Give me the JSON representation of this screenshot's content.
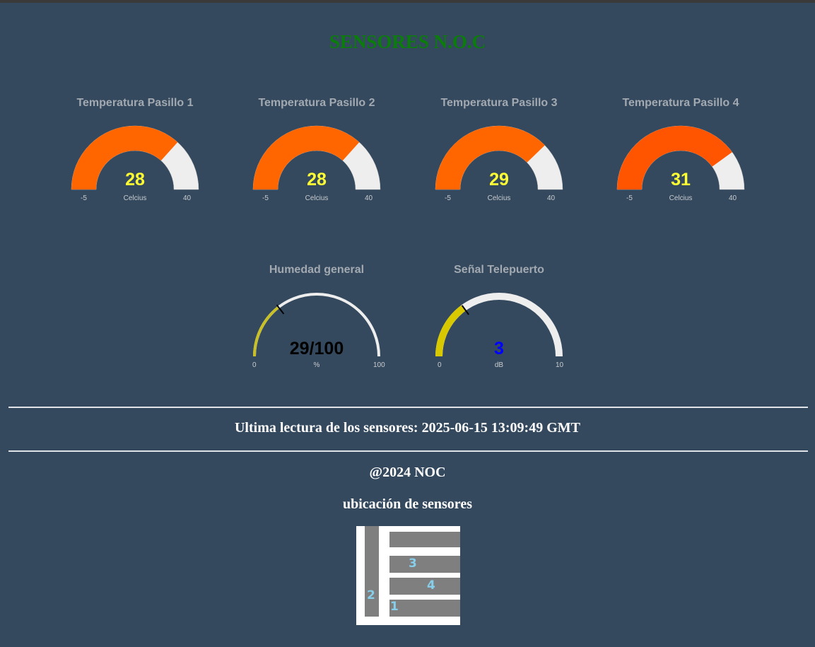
{
  "title": "SENSORES N.O.C",
  "temperature_gauges": [
    {
      "label": "Temperatura Pasillo 1",
      "value": 28,
      "unit": "Celcius",
      "min": -5,
      "max": 40,
      "fill_color": "#ff6600"
    },
    {
      "label": "Temperatura Pasillo 2",
      "value": 28,
      "unit": "Celcius",
      "min": -5,
      "max": 40,
      "fill_color": "#ff6600"
    },
    {
      "label": "Temperatura Pasillo 3",
      "value": 29,
      "unit": "Celcius",
      "min": -5,
      "max": 40,
      "fill_color": "#ff6600"
    },
    {
      "label": "Temperatura Pasillo 4",
      "value": 31,
      "unit": "Celcius",
      "min": -5,
      "max": 40,
      "fill_color": "#ff5500"
    }
  ],
  "humidity_gauge": {
    "label": "Humedad general",
    "value_text": "29/100",
    "value": 29,
    "unit": "%",
    "min": 0,
    "max": 100,
    "fill_color": "#c8c026",
    "value_color": "#000000"
  },
  "signal_gauge": {
    "label": "Señal Telepuerto",
    "value_text": "3",
    "value": 3,
    "unit": "dB",
    "min": 0,
    "max": 10,
    "fill_color": "#d8c800",
    "value_color": "#0000ff"
  },
  "last_reading": "Ultima lectura de los sensores: 2025-06-15 13:09:49 GMT",
  "footer": {
    "copyright": "@2024 NOC",
    "location_heading": "ubicación de sensores"
  },
  "location_map": {
    "labels": [
      "1",
      "2",
      "3",
      "4"
    ]
  },
  "colors": {
    "background": "#34495e",
    "title": "#0a7d0a",
    "value_text": "#ffff33",
    "track": "#eeeeee"
  }
}
